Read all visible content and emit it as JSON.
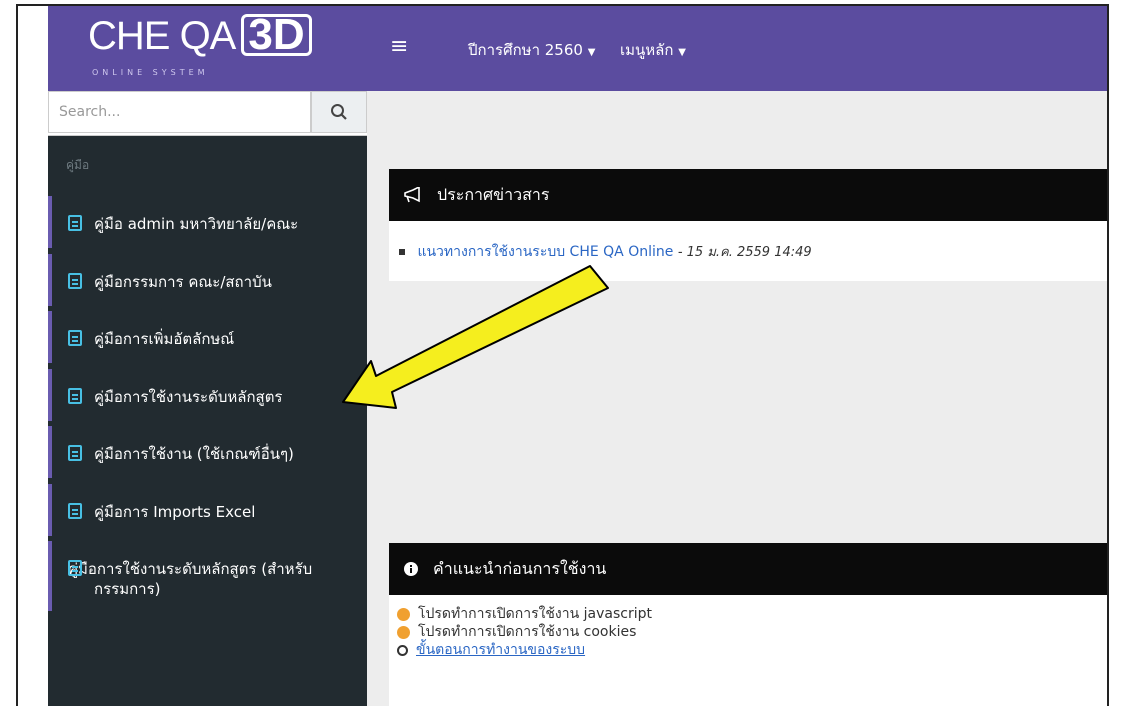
{
  "brand": {
    "logo_main": "CHE QA",
    "logo_3d": "3D",
    "logo_sub": "ONLINE SYSTEM"
  },
  "topbar": {
    "academic_year": "ปีการศึกษา 2560",
    "main_menu": "เมนูหลัก"
  },
  "sidebar": {
    "search_placeholder": "Search...",
    "section_label": "คู่มือ",
    "items": [
      {
        "label": "คู่มือ admin มหาวิทยาลัย/คณะ"
      },
      {
        "label": "คู่มือกรรมการ คณะ/สถาบัน"
      },
      {
        "label": "คู่มือการเพิ่มอัตลักษณ์"
      },
      {
        "label": "คู่มือการใช้งานระดับหลักสูตร"
      },
      {
        "label": "คู่มือการใช้งาน (ใช้เกณฑ์อื่นๆ)"
      },
      {
        "label": "คู่มือการ Imports Excel"
      },
      {
        "label": "คู่มือการใช้งานระดับหลักสูตร (สำหรับกรรมการ)"
      }
    ]
  },
  "news": {
    "title": "ประกาศข่าวสาร",
    "items": [
      {
        "link": "แนวทางการใช้งานระบบ CHE QA Online",
        "date": "15 ม.ค. 2559 14:49"
      }
    ]
  },
  "advice": {
    "title": "คำแนะนำก่อนการใช้งาน",
    "items": [
      {
        "text": "โปรดทำการเปิดการใช้งาน javascript",
        "kind": "warning"
      },
      {
        "text": "โปรดทำการเปิดการใช้งาน cookies",
        "kind": "warning"
      },
      {
        "text": "ขั้นตอนการทำงานของระบบ",
        "kind": "link"
      }
    ]
  },
  "colors": {
    "topbar": "#5b4c9f",
    "sidebar": "#222b30",
    "accent_border": "#6a5cb0",
    "arrow_fill": "#f5ee1e"
  },
  "annotation": {
    "type": "yellow-arrow",
    "points_to": "คู่มือการใช้งานระดับหลักสูตร"
  }
}
